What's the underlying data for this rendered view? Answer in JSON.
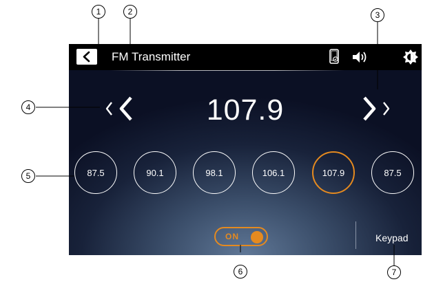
{
  "header": {
    "title": "FM Transmitter",
    "icons": [
      "back-icon",
      "phone-sync-icon",
      "volume-icon",
      "brightness-icon"
    ]
  },
  "frequency": {
    "value": "107.9"
  },
  "presets": [
    "87.5",
    "90.1",
    "98.1",
    "106.1",
    "107.9",
    "87.5"
  ],
  "active_preset_index": 4,
  "toggle": {
    "label": "ON",
    "state": true
  },
  "keypad_label": "Keypad",
  "callouts": [
    "1",
    "2",
    "3",
    "4",
    "5",
    "6",
    "7"
  ],
  "colors": {
    "accent": "#e58a1f",
    "topbar": "#000000",
    "text": "#ffffff"
  }
}
